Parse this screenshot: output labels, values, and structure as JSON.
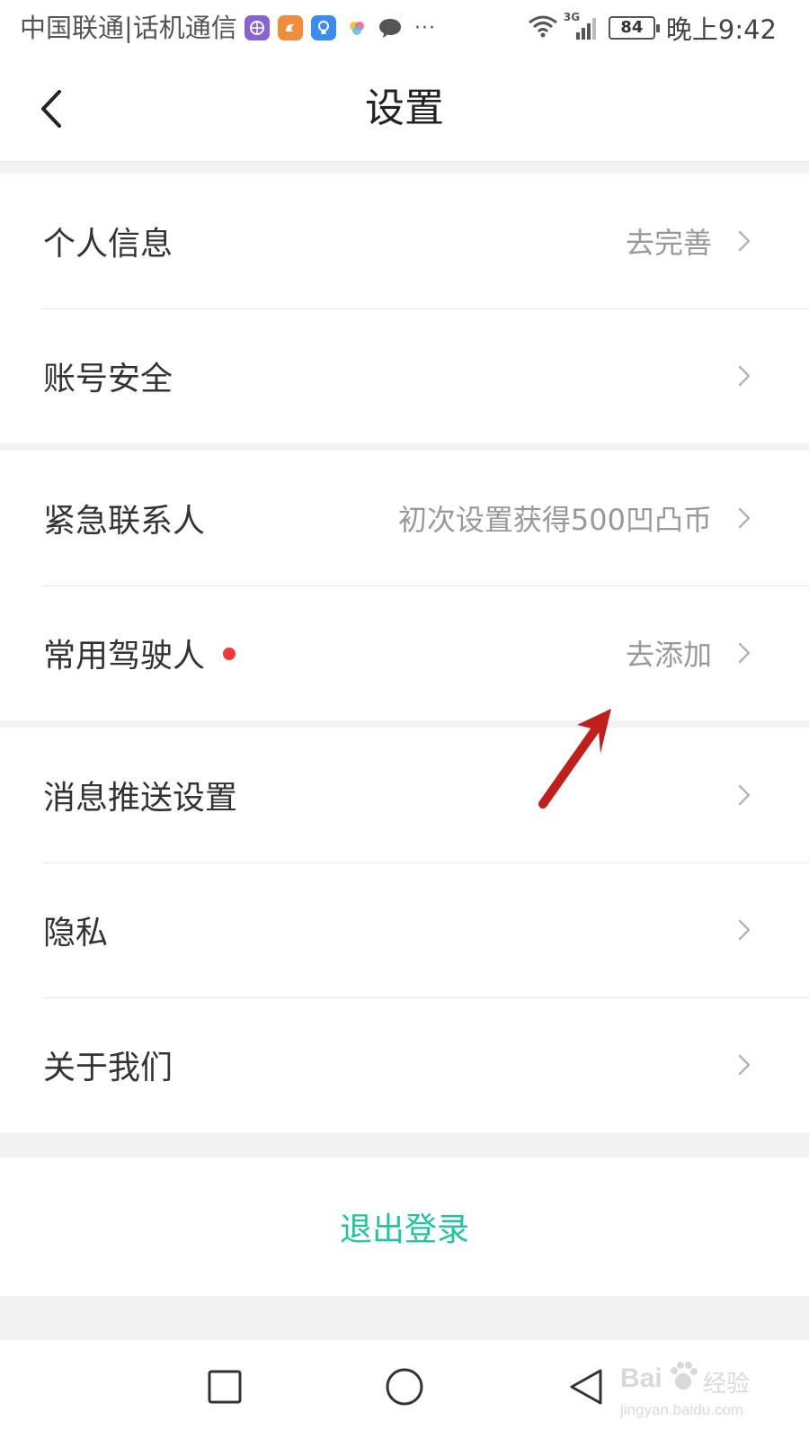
{
  "status_bar": {
    "carrier": "中国联通|话机通信",
    "app_icons": [
      {
        "name": "browser-icon",
        "color": "#8a63d2"
      },
      {
        "name": "uc-browser-icon",
        "color": "#f08c3c"
      },
      {
        "name": "lightbulb-icon",
        "color": "#3b8cf0"
      },
      {
        "name": "photos-icon",
        "color": "#f4c542"
      },
      {
        "name": "chat-bubble-icon",
        "color": "#555555"
      }
    ],
    "more": "···",
    "network": "3G",
    "battery": "84",
    "time": "晚上9:42"
  },
  "header": {
    "title": "设置"
  },
  "groups": [
    {
      "items": [
        {
          "label": "个人信息",
          "hint": "去完善"
        },
        {
          "label": "账号安全",
          "hint": ""
        }
      ]
    },
    {
      "items": [
        {
          "label": "紧急联系人",
          "hint": "初次设置获得500凹凸币"
        },
        {
          "label": "常用驾驶人",
          "hint": "去添加",
          "badge": "red-dot"
        }
      ]
    },
    {
      "items": [
        {
          "label": "消息推送设置",
          "hint": ""
        },
        {
          "label": "隐私",
          "hint": ""
        },
        {
          "label": "关于我们",
          "hint": ""
        }
      ]
    }
  ],
  "logout": {
    "label": "退出登录",
    "color": "#21c3a0"
  },
  "nav_bar": {
    "buttons": [
      "recent-apps",
      "home",
      "back"
    ]
  },
  "annotation": {
    "arrow_color": "#c0201c"
  },
  "watermark": {
    "brand": "Bai",
    "brand_suffix": "经验",
    "url": "jingyan.baidu.com"
  }
}
